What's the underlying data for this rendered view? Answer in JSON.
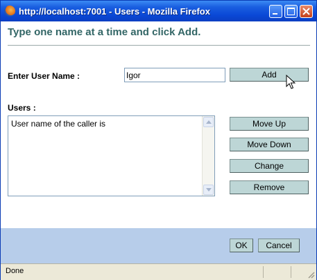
{
  "window": {
    "title": "http://localhost:7001 - Users - Mozilla Firefox",
    "controls": {
      "minimize": "minimize-icon",
      "maximize": "maximize-icon",
      "close": "close-icon"
    }
  },
  "instruction": "Type one name at a time and click Add.",
  "form": {
    "user_name_label": "Enter User Name :",
    "user_name_value": "Igor",
    "add_label": "Add",
    "users_label": "Users :",
    "users_list": [
      "User name of the caller is"
    ],
    "move_up_label": "Move Up",
    "move_down_label": "Move Down",
    "change_label": "Change",
    "remove_label": "Remove"
  },
  "footer": {
    "ok_label": "OK",
    "cancel_label": "Cancel"
  },
  "status": {
    "text": "Done"
  },
  "colors": {
    "heading": "#336666",
    "button_bg": "#bdd6d6",
    "footer_bg": "#b7cdea",
    "titlebar": "#0a48d6"
  }
}
